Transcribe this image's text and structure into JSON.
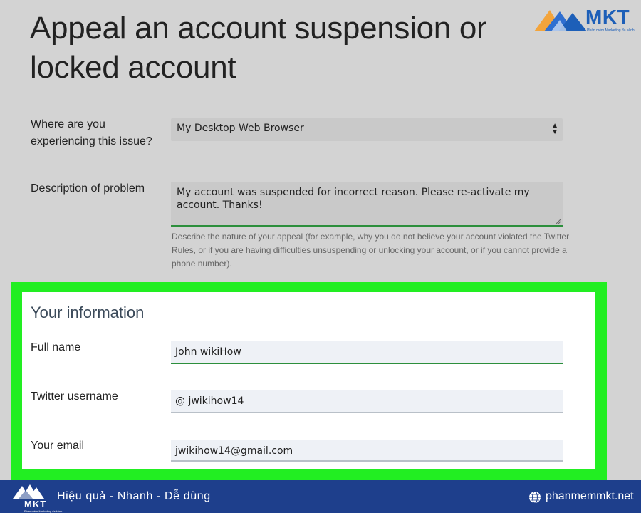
{
  "page": {
    "title": "Appeal an account suspension or locked account"
  },
  "brand": {
    "logo_text": "MKT",
    "logo_subtitle": "Phần mềm Marketing đa kênh",
    "tagline": "Hiệu quả - Nhanh  - Dễ dùng",
    "website": "phanmemmkt.net",
    "primary_color": "#1e3f8c",
    "accent_color": "#22ee22"
  },
  "form": {
    "platform": {
      "label": "Where are you experiencing this issue?",
      "value": "My Desktop Web Browser"
    },
    "description": {
      "label": "Description of problem",
      "value": "My account was suspended for incorrect reason. Please re-activate my account. Thanks!",
      "help": "Describe the nature of your appeal (for example, why you do not believe your account violated the Twitter Rules, or if you are having difficulties unsuspending or unlocking your account, or if you cannot provide a phone number)."
    },
    "your_information": {
      "heading": "Your information",
      "full_name": {
        "label": "Full name",
        "value": "John wikiHow"
      },
      "username": {
        "label": "Twitter username",
        "value": "@ jwikihow14"
      },
      "email": {
        "label": "Your email",
        "value": "jwikihow14@gmail.com"
      }
    }
  },
  "icons": {
    "select_arrow": "updown-arrow-icon",
    "globe": "globe-icon",
    "logo": "mountain-logo-icon"
  }
}
